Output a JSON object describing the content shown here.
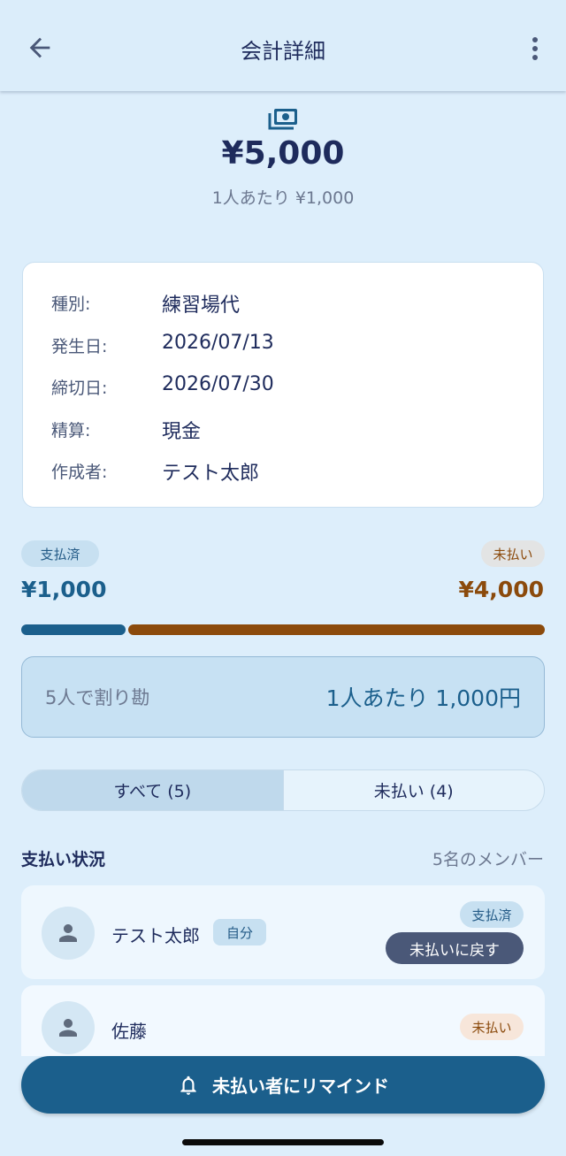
{
  "header": {
    "title": "会計詳細",
    "back_icon": "arrow-left-icon",
    "menu_icon": "more-vert-icon"
  },
  "summary": {
    "icon": "money-icon",
    "total": "¥5,000",
    "per_person": "1人あたり ¥1,000"
  },
  "details": [
    {
      "label": "種別:",
      "value": "練習場代"
    },
    {
      "label": "発生日:",
      "value": "2026/07/13"
    },
    {
      "label": "締切日:",
      "value": "2026/07/30"
    },
    {
      "label": "精算:",
      "value": "現金"
    },
    {
      "label": "作成者:",
      "value": "テスト太郎"
    }
  ],
  "progress": {
    "paid_label": "支払済",
    "paid_amount": "¥1,000",
    "unpaid_label": "未払い",
    "unpaid_amount": "¥4,000",
    "paid_fraction": 0.2,
    "paid_color": "#1b5f8c",
    "unpaid_color": "#8b4a0c"
  },
  "split": {
    "left": "5人で割り勘",
    "right": "1人あたり 1,000円"
  },
  "tabs": [
    {
      "label": "すべて (5)",
      "active": true
    },
    {
      "label": "未払い (4)",
      "active": false
    }
  ],
  "members_section": {
    "title": "支払い状況",
    "count": "5名のメンバー"
  },
  "members": [
    {
      "name": "テスト太郎",
      "badge": "自分",
      "status": "支払済",
      "action": "未払いに戻す"
    },
    {
      "name": "佐藤",
      "status": "未払い"
    }
  ],
  "remind_button": {
    "label": "未払い者にリマインド",
    "icon": "bell-icon"
  }
}
